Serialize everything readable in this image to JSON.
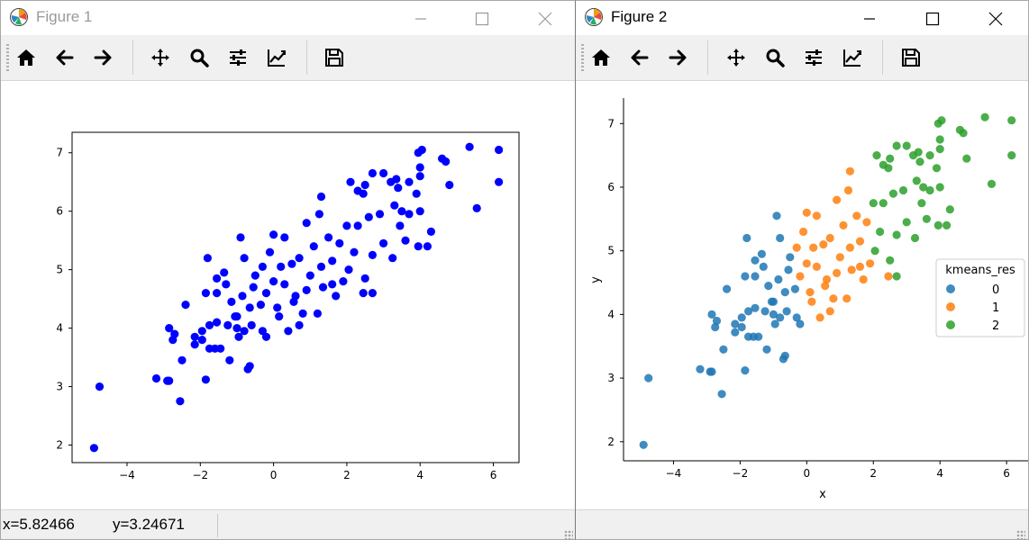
{
  "windows": [
    {
      "title": "Figure 1",
      "statusbar": {
        "x_readout": "x=5.82466",
        "y_readout": "y=3.24671"
      }
    },
    {
      "title": "Figure 2",
      "legend": {
        "title": "kmeans_res",
        "entries": [
          "0",
          "1",
          "2"
        ]
      }
    }
  ],
  "toolbar_icons": [
    "home-icon",
    "back-arrow-icon",
    "forward-arrow-icon",
    "pan-icon",
    "zoom-icon",
    "configure-subplots-icon",
    "edit-axis-icon",
    "save-icon"
  ],
  "colors": {
    "figure1_points": "#0000ff",
    "cluster_0": "#1f77b4",
    "cluster_1": "#ff7f0e",
    "cluster_2": "#2ca02c"
  },
  "chart_data": [
    {
      "type": "scatter",
      "figure": "Figure 1",
      "title": "",
      "xlabel": "",
      "ylabel": "",
      "xlim": [
        -5.5,
        6.7
      ],
      "ylim": [
        1.7,
        7.35
      ],
      "xticks": [
        "−4",
        "−2",
        "0",
        "2",
        "4",
        "6"
      ],
      "xtick_values": [
        -4,
        -2,
        0,
        2,
        4,
        6
      ],
      "yticks": [
        "2",
        "3",
        "4",
        "5",
        "6",
        "7"
      ],
      "ytick_values": [
        2,
        3,
        4,
        5,
        6,
        7
      ],
      "points": [
        [
          -4.9,
          1.95
        ],
        [
          -4.75,
          3.0
        ],
        [
          -2.55,
          2.75
        ],
        [
          -3.2,
          3.14
        ],
        [
          -2.9,
          3.1
        ],
        [
          -2.85,
          3.1
        ],
        [
          -2.5,
          3.45
        ],
        [
          -1.85,
          3.12
        ],
        [
          -1.2,
          3.45
        ],
        [
          -0.7,
          3.3
        ],
        [
          -0.65,
          3.35
        ],
        [
          -2.15,
          3.85
        ],
        [
          -2.15,
          3.72
        ],
        [
          -2.75,
          3.8
        ],
        [
          -2.7,
          3.9
        ],
        [
          -2.85,
          4.0
        ],
        [
          -1.95,
          3.8
        ],
        [
          -1.95,
          3.95
        ],
        [
          -1.75,
          3.65
        ],
        [
          -1.6,
          3.65
        ],
        [
          -1.45,
          3.65
        ],
        [
          -1.75,
          4.05
        ],
        [
          -1.55,
          4.1
        ],
        [
          -1.25,
          4.05
        ],
        [
          -1.0,
          4.0
        ],
        [
          -1.0,
          4.2
        ],
        [
          -0.95,
          3.85
        ],
        [
          -0.8,
          3.95
        ],
        [
          -0.6,
          4.05
        ],
        [
          -0.3,
          3.95
        ],
        [
          -0.2,
          3.85
        ],
        [
          0.4,
          3.95
        ],
        [
          -2.4,
          4.4
        ],
        [
          -1.85,
          4.6
        ],
        [
          -1.55,
          4.6
        ],
        [
          -1.3,
          4.75
        ],
        [
          -1.15,
          4.45
        ],
        [
          -0.85,
          4.55
        ],
        [
          -0.65,
          4.35
        ],
        [
          -0.35,
          4.4
        ],
        [
          0.15,
          4.2
        ],
        [
          -1.8,
          5.2
        ],
        [
          -1.55,
          4.85
        ],
        [
          -1.35,
          4.95
        ],
        [
          -0.9,
          5.55
        ],
        [
          -0.8,
          5.2
        ],
        [
          -0.5,
          4.9
        ],
        [
          -0.3,
          5.05
        ],
        [
          -0.2,
          4.6
        ],
        [
          0.3,
          4.75
        ],
        [
          -0.1,
          5.3
        ],
        [
          0.0,
          5.6
        ],
        [
          0.3,
          5.55
        ],
        [
          0.2,
          5.05
        ],
        [
          0.1,
          4.35
        ],
        [
          0.6,
          4.55
        ],
        [
          0.8,
          4.25
        ],
        [
          1.2,
          4.25
        ],
        [
          0.9,
          4.65
        ],
        [
          1.0,
          4.9
        ],
        [
          0.5,
          5.1
        ],
        [
          0.7,
          5.2
        ],
        [
          1.3,
          5.05
        ],
        [
          1.1,
          5.4
        ],
        [
          0.9,
          5.8
        ],
        [
          1.25,
          5.95
        ],
        [
          1.3,
          6.25
        ],
        [
          0.7,
          4.05
        ],
        [
          1.6,
          4.75
        ],
        [
          1.7,
          4.55
        ],
        [
          1.6,
          5.15
        ],
        [
          1.8,
          5.45
        ],
        [
          2.0,
          5.75
        ],
        [
          2.2,
          5.3
        ],
        [
          2.05,
          5.0
        ],
        [
          1.9,
          4.8
        ],
        [
          2.45,
          4.6
        ],
        [
          2.5,
          4.85
        ],
        [
          2.7,
          5.25
        ],
        [
          2.3,
          5.75
        ],
        [
          2.6,
          5.9
        ],
        [
          2.9,
          5.95
        ],
        [
          2.45,
          6.3
        ],
        [
          2.1,
          6.5
        ],
        [
          2.3,
          6.35
        ],
        [
          2.5,
          6.45
        ],
        [
          2.7,
          6.65
        ],
        [
          3.0,
          6.65
        ],
        [
          3.2,
          6.5
        ],
        [
          3.35,
          6.55
        ],
        [
          3.4,
          6.4
        ],
        [
          3.7,
          6.5
        ],
        [
          3.9,
          6.3
        ],
        [
          4.0,
          6.6
        ],
        [
          4.0,
          6.75
        ],
        [
          3.95,
          7.0
        ],
        [
          4.05,
          7.05
        ],
        [
          3.3,
          6.1
        ],
        [
          3.5,
          6.0
        ],
        [
          3.7,
          5.95
        ],
        [
          4.0,
          6.0
        ],
        [
          4.3,
          5.65
        ],
        [
          3.6,
          5.5
        ],
        [
          3.95,
          5.4
        ],
        [
          4.2,
          5.4
        ],
        [
          3.0,
          5.45
        ],
        [
          3.25,
          5.2
        ],
        [
          3.45,
          5.75
        ],
        [
          4.6,
          6.9
        ],
        [
          4.7,
          6.85
        ],
        [
          4.8,
          6.45
        ],
        [
          5.35,
          7.1
        ],
        [
          5.55,
          6.05
        ],
        [
          6.15,
          7.05
        ],
        [
          6.15,
          6.5
        ],
        [
          2.7,
          4.6
        ],
        [
          1.35,
          4.7
        ],
        [
          1.5,
          5.55
        ],
        [
          0.55,
          4.45
        ],
        [
          -0.55,
          4.7
        ],
        [
          -1.05,
          4.2
        ],
        [
          0.0,
          4.8
        ]
      ]
    },
    {
      "type": "scatter",
      "figure": "Figure 2",
      "title": "",
      "xlabel": "x",
      "ylabel": "y",
      "xlim": [
        -5.5,
        6.7
      ],
      "ylim": [
        1.7,
        7.4
      ],
      "xticks": [
        "−4",
        "−2",
        "0",
        "2",
        "4",
        "6"
      ],
      "xtick_values": [
        -4,
        -2,
        0,
        2,
        4,
        6
      ],
      "yticks": [
        "2",
        "3",
        "4",
        "5",
        "6",
        "7"
      ],
      "ytick_values": [
        2,
        3,
        4,
        5,
        6,
        7
      ],
      "legend": {
        "title": "kmeans_res",
        "entries": [
          "0",
          "1",
          "2"
        ],
        "placement": "center-right"
      },
      "series": [
        {
          "name": "0",
          "points": [
            [
              -4.9,
              1.95
            ],
            [
              -4.75,
              3.0
            ],
            [
              -2.55,
              2.75
            ],
            [
              -3.2,
              3.14
            ],
            [
              -2.9,
              3.1
            ],
            [
              -2.85,
              3.1
            ],
            [
              -2.5,
              3.45
            ],
            [
              -1.85,
              3.12
            ],
            [
              -1.2,
              3.45
            ],
            [
              -0.7,
              3.3
            ],
            [
              -0.65,
              3.35
            ],
            [
              -2.15,
              3.85
            ],
            [
              -2.15,
              3.72
            ],
            [
              -2.75,
              3.8
            ],
            [
              -2.7,
              3.9
            ],
            [
              -2.85,
              4.0
            ],
            [
              -1.95,
              3.8
            ],
            [
              -1.95,
              3.95
            ],
            [
              -1.75,
              3.65
            ],
            [
              -1.6,
              3.65
            ],
            [
              -1.45,
              3.65
            ],
            [
              -1.75,
              4.05
            ],
            [
              -1.55,
              4.1
            ],
            [
              -1.25,
              4.05
            ],
            [
              -1.0,
              4.0
            ],
            [
              -1.0,
              4.2
            ],
            [
              -0.95,
              3.85
            ],
            [
              -0.8,
              3.95
            ],
            [
              -0.6,
              4.05
            ],
            [
              -0.3,
              3.95
            ],
            [
              -0.2,
              3.85
            ],
            [
              -2.4,
              4.4
            ],
            [
              -1.85,
              4.6
            ],
            [
              -1.55,
              4.6
            ],
            [
              -1.3,
              4.75
            ],
            [
              -1.15,
              4.45
            ],
            [
              -0.85,
              4.55
            ],
            [
              -0.65,
              4.35
            ],
            [
              -0.35,
              4.4
            ],
            [
              -1.8,
              5.2
            ],
            [
              -1.55,
              4.85
            ],
            [
              -1.35,
              4.95
            ],
            [
              -0.9,
              5.55
            ],
            [
              -0.8,
              5.2
            ],
            [
              -0.5,
              4.9
            ],
            [
              -0.55,
              4.7
            ],
            [
              -1.05,
              4.2
            ]
          ]
        },
        {
          "name": "1",
          "points": [
            [
              0.4,
              3.95
            ],
            [
              0.15,
              4.2
            ],
            [
              -0.3,
              5.05
            ],
            [
              -0.2,
              4.6
            ],
            [
              0.3,
              4.75
            ],
            [
              -0.1,
              5.3
            ],
            [
              0.0,
              5.6
            ],
            [
              0.3,
              5.55
            ],
            [
              0.2,
              5.05
            ],
            [
              0.1,
              4.35
            ],
            [
              0.6,
              4.55
            ],
            [
              0.8,
              4.25
            ],
            [
              1.2,
              4.25
            ],
            [
              0.9,
              4.65
            ],
            [
              1.0,
              4.9
            ],
            [
              0.5,
              5.1
            ],
            [
              0.7,
              5.2
            ],
            [
              1.3,
              5.05
            ],
            [
              1.1,
              5.4
            ],
            [
              0.9,
              5.8
            ],
            [
              1.25,
              5.95
            ],
            [
              1.3,
              6.25
            ],
            [
              0.7,
              4.05
            ],
            [
              1.6,
              4.75
            ],
            [
              1.7,
              4.55
            ],
            [
              1.6,
              5.15
            ],
            [
              1.8,
              5.45
            ],
            [
              1.9,
              4.8
            ],
            [
              2.45,
              4.6
            ],
            [
              1.35,
              4.7
            ],
            [
              1.5,
              5.55
            ],
            [
              0.55,
              4.45
            ],
            [
              0.0,
              4.8
            ]
          ]
        },
        {
          "name": "2",
          "points": [
            [
              2.0,
              5.75
            ],
            [
              2.2,
              5.3
            ],
            [
              2.05,
              5.0
            ],
            [
              2.5,
              4.85
            ],
            [
              2.7,
              5.25
            ],
            [
              2.3,
              5.75
            ],
            [
              2.6,
              5.9
            ],
            [
              2.9,
              5.95
            ],
            [
              2.45,
              6.3
            ],
            [
              2.1,
              6.5
            ],
            [
              2.3,
              6.35
            ],
            [
              2.5,
              6.45
            ],
            [
              2.7,
              6.65
            ],
            [
              3.0,
              6.65
            ],
            [
              3.2,
              6.5
            ],
            [
              3.35,
              6.55
            ],
            [
              3.4,
              6.4
            ],
            [
              3.7,
              6.5
            ],
            [
              3.9,
              6.3
            ],
            [
              4.0,
              6.6
            ],
            [
              4.0,
              6.75
            ],
            [
              3.95,
              7.0
            ],
            [
              4.05,
              7.05
            ],
            [
              3.3,
              6.1
            ],
            [
              3.5,
              6.0
            ],
            [
              3.7,
              5.95
            ],
            [
              4.0,
              6.0
            ],
            [
              4.3,
              5.65
            ],
            [
              3.6,
              5.5
            ],
            [
              3.95,
              5.4
            ],
            [
              4.2,
              5.4
            ],
            [
              3.0,
              5.45
            ],
            [
              3.25,
              5.2
            ],
            [
              3.45,
              5.75
            ],
            [
              4.6,
              6.9
            ],
            [
              4.7,
              6.85
            ],
            [
              4.8,
              6.45
            ],
            [
              5.35,
              7.1
            ],
            [
              5.55,
              6.05
            ],
            [
              6.15,
              7.05
            ],
            [
              6.15,
              6.5
            ],
            [
              2.7,
              4.6
            ]
          ]
        }
      ]
    }
  ]
}
